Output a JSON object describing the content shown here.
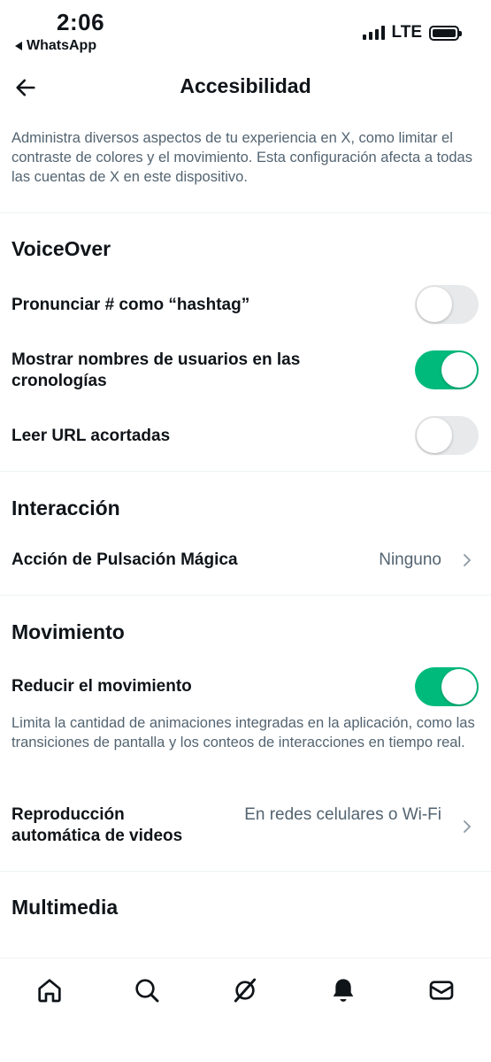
{
  "status_bar": {
    "time": "2:06",
    "back_app": "WhatsApp",
    "network": "LTE"
  },
  "header": {
    "title": "Accesibilidad"
  },
  "intro_text": "Administra diversos aspectos de tu experiencia en X, como limitar el contraste de colores y el movimiento. Esta configuración afecta a todas las cuentas de X en este dispositivo.",
  "sections": {
    "voiceover": {
      "title": "VoiceOver",
      "items": [
        {
          "label": "Pronunciar # como “hashtag”",
          "enabled": false
        },
        {
          "label": "Mostrar nombres de usuarios en las cronologías",
          "enabled": true
        },
        {
          "label": "Leer URL acortadas",
          "enabled": false
        }
      ]
    },
    "interaction": {
      "title": "Interacción",
      "magic_tap_label": "Acción de Pulsación Mágica",
      "magic_tap_value": "Ninguno"
    },
    "motion": {
      "title": "Movimiento",
      "reduce_motion_label": "Reducir el movimiento",
      "reduce_motion_enabled": true,
      "reduce_motion_desc": "Limita la cantidad de animaciones integradas en la aplicación, como las transiciones de pantalla y los conteos de interacciones en tiempo real.",
      "autoplay_label": "Reproducción automática de videos",
      "autoplay_value": "En redes celulares o Wi-Fi"
    },
    "media": {
      "title": "Multimedia"
    }
  },
  "bottom_nav": {
    "items": [
      "home-icon",
      "search-icon",
      "grok-icon",
      "notifications-icon",
      "messages-icon"
    ]
  },
  "colors": {
    "toggle_on": "#00ba7c",
    "toggle_off": "#e7e9ea",
    "secondary_text": "#536471"
  }
}
